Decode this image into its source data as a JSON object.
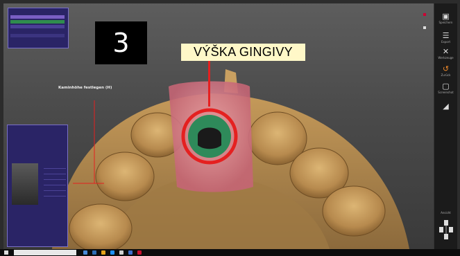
{
  "step_number": "3",
  "highlight_label": "VÝŠKA GINGIVY",
  "viewport": {
    "annotation": "Kaminhöhe festlegen (H)"
  },
  "colors": {
    "accent_red": "#e52020",
    "label_bg": "#fff8c8",
    "panel_bg": "#2a2466",
    "tooth": "#c49a5c",
    "gingiva": "#d87a86",
    "scanbody": "#2e8a5a"
  },
  "sidebar": {
    "tools": [
      {
        "icon": "save-icon",
        "label": "Speichern"
      },
      {
        "icon": "export-icon",
        "label": "Export"
      },
      {
        "icon": "tools-icon",
        "label": "Werkzeuge"
      },
      {
        "icon": "undo-icon",
        "label": "Zurück"
      },
      {
        "icon": "screenshot-icon",
        "label": "Screenshot"
      },
      {
        "icon": "cleanup-icon",
        "label": ""
      }
    ],
    "view_label": "Ansicht"
  }
}
